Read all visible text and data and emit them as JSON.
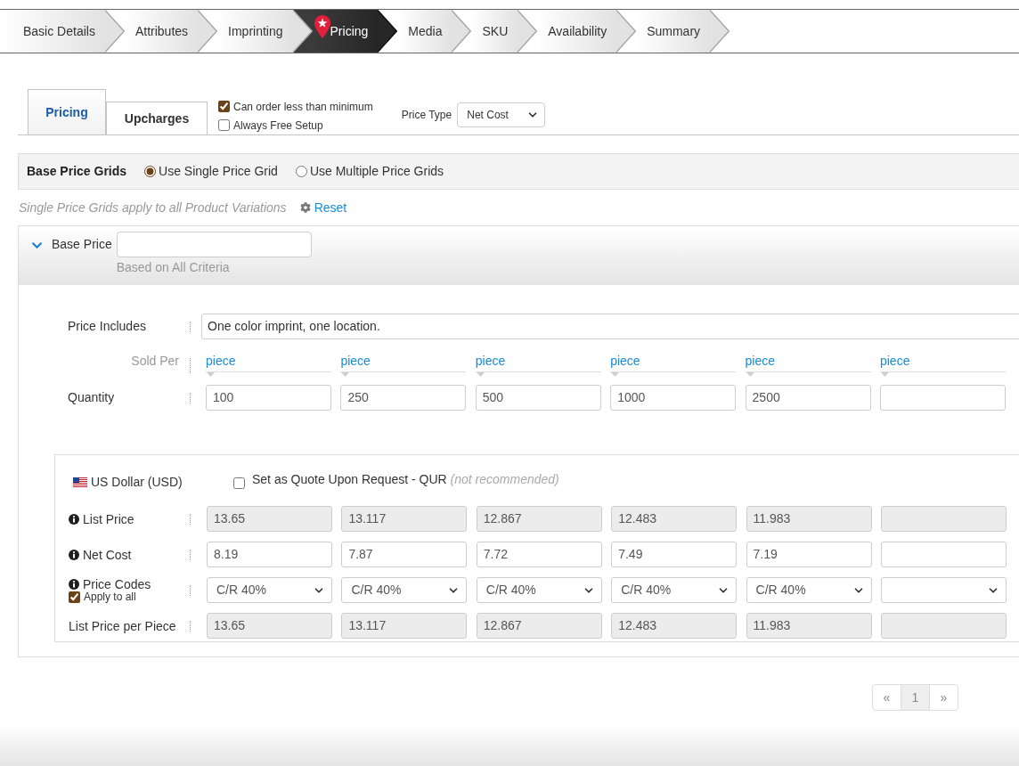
{
  "steps": [
    {
      "label": "Basic Details",
      "selected": false
    },
    {
      "label": "Attributes",
      "selected": false
    },
    {
      "label": "Imprinting",
      "selected": false
    },
    {
      "label": "Pricing",
      "selected": true
    },
    {
      "label": "Media",
      "selected": false
    },
    {
      "label": "SKU",
      "selected": false
    },
    {
      "label": "Availability",
      "selected": false
    },
    {
      "label": "Summary",
      "selected": false
    }
  ],
  "tabs": [
    {
      "label": "Pricing",
      "selected": true
    },
    {
      "label": "Upcharges",
      "selected": false
    }
  ],
  "options": [
    {
      "label": "Can order less than minimum",
      "checked": true
    },
    {
      "label": "Always Free Setup",
      "checked": false
    }
  ],
  "price_type": {
    "label": "Price Type",
    "value": "Net Cost"
  },
  "base_price_grids": {
    "title": "Base Price Grids",
    "choices": [
      {
        "label": "Use Single Price Grid",
        "selected": true
      },
      {
        "label": "Use Multiple Price Grids",
        "selected": false
      }
    ]
  },
  "note": "Single Price Grids apply to all Product Variations",
  "reset": "Reset",
  "base_price": {
    "label": "Base Price",
    "expanded": true,
    "hint": "Based on All Criteria"
  },
  "price_includes": {
    "label": "Price Includes",
    "value": "One color imprint, one location."
  },
  "sold_per": {
    "label": "Sold Per",
    "values": [
      "piece",
      "piece",
      "piece",
      "piece",
      "piece",
      "piece"
    ]
  },
  "quantity": {
    "label": "Quantity",
    "values": [
      "100",
      "250",
      "500",
      "1000",
      "2500"
    ]
  },
  "currency": {
    "label": "US Dollar (USD)",
    "quote_request": {
      "label": "Set as Quote Upon Request - QUR *(not recommended)*",
      "checked": false
    },
    "rows": [
      {
        "kind": "computed",
        "label": "List Price",
        "info": true,
        "values": [
          "13.65",
          "13.117",
          "12.867",
          "12.483",
          "11.983"
        ]
      },
      {
        "kind": "input",
        "label": "Net Cost",
        "info": true,
        "values": [
          "8.19",
          "7.87",
          "7.72",
          "7.49",
          "7.19"
        ]
      },
      {
        "kind": "select",
        "label": "Price Codes",
        "info": true,
        "apply_to_all": {
          "label": "Apply to all",
          "checked": true
        },
        "values": [
          "C/R 40%",
          "C/R 40%",
          "C/R 40%",
          "C/R 40%",
          "C/R 40%"
        ]
      },
      {
        "kind": "computed",
        "label": "List Price per Piece",
        "info": false,
        "values": [
          "13.65",
          "13.117",
          "12.867",
          "12.483",
          "11.983"
        ]
      }
    ]
  },
  "pagination": {
    "previous": "«",
    "pages": [
      {
        "label": "1",
        "selected": true
      }
    ],
    "next": "»"
  }
}
